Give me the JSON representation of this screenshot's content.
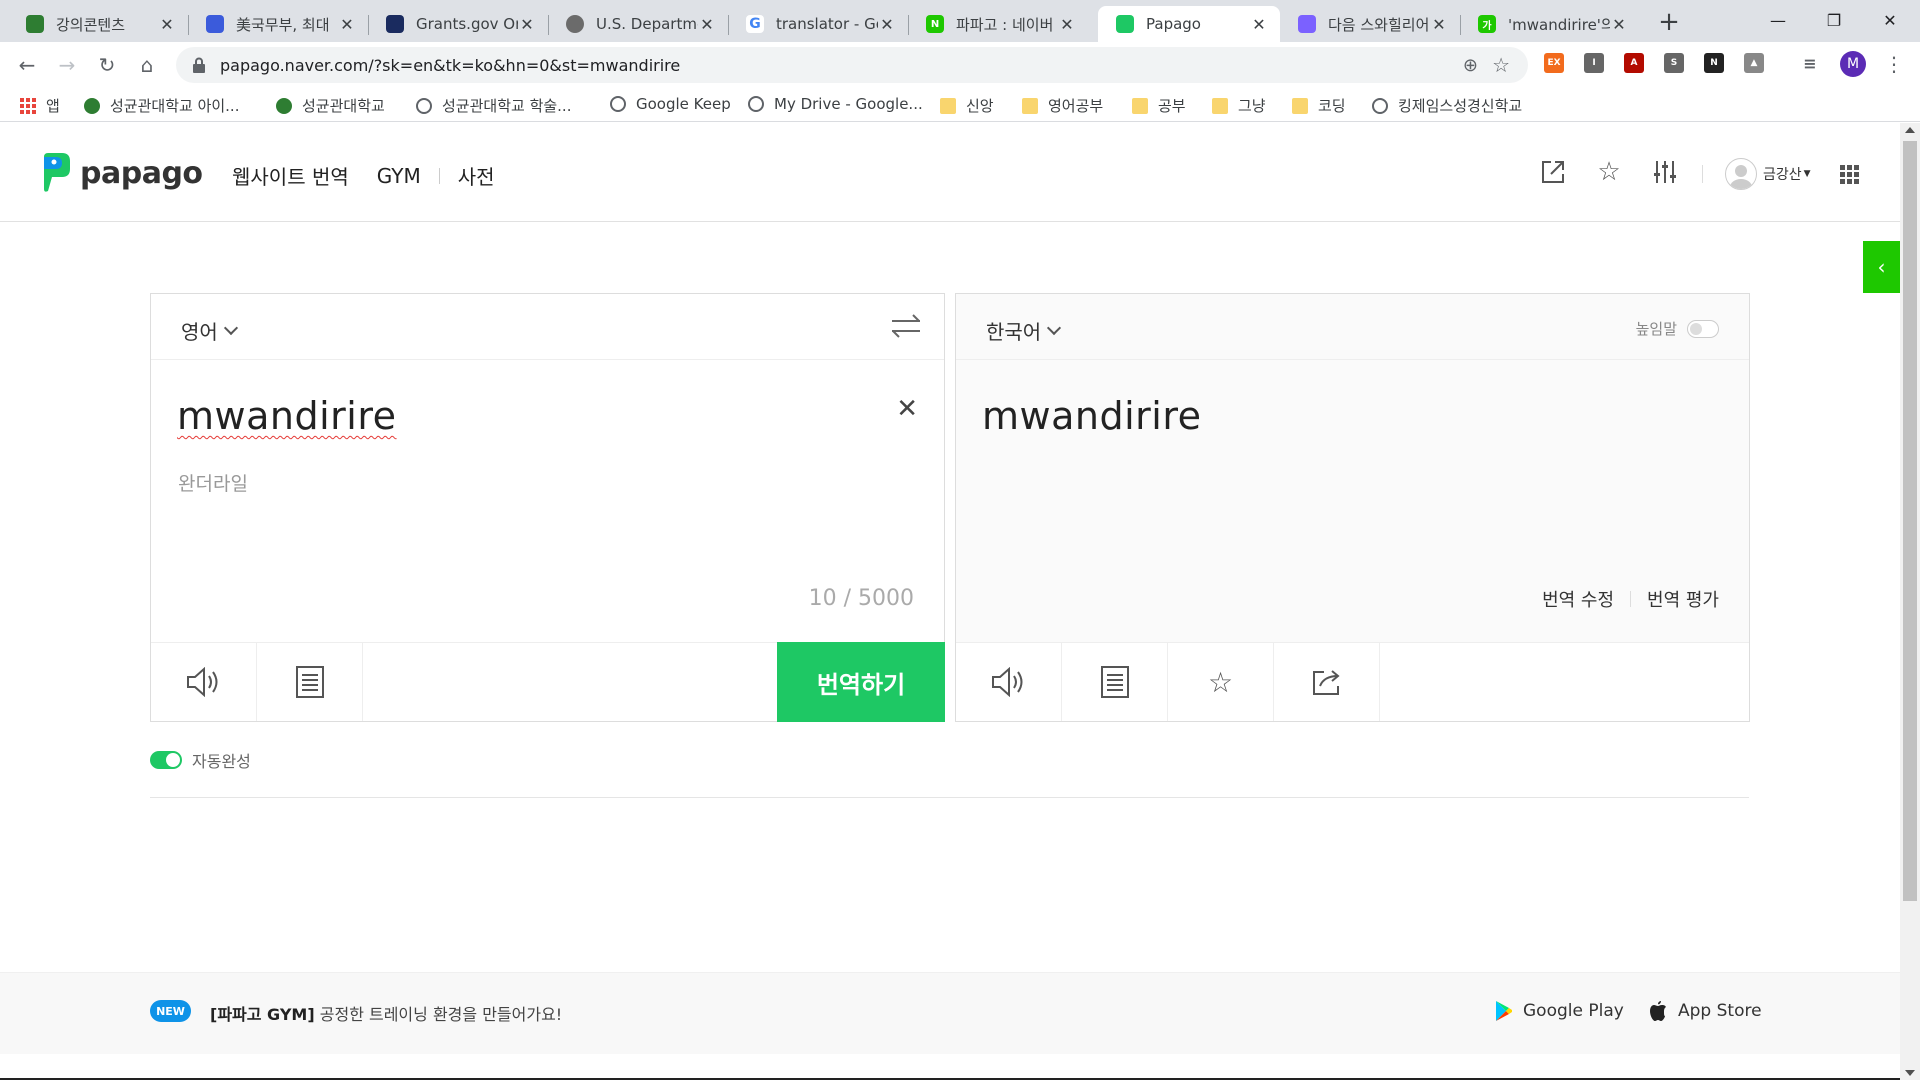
{
  "browser": {
    "tabs": [
      {
        "title": "강의콘텐츠",
        "favicon": "skku-icon",
        "color": "#2e7d32"
      },
      {
        "title": "美국무부, 최대",
        "favicon": "shield-icon",
        "color": "#3b5bdb"
      },
      {
        "title": "Grants.gov Onl",
        "favicon": "grants-icon",
        "color": "#1a2b5f"
      },
      {
        "title": "U.S. Departmen",
        "favicon": "seal-icon",
        "color": "#6b6b6b"
      },
      {
        "title": "translator - Go",
        "favicon": "google-icon",
        "color": "#4285f4"
      },
      {
        "title": "파파고 : 네이버",
        "favicon": "naver-icon",
        "color": "#1ec800"
      },
      {
        "title": "Papago",
        "favicon": "papago-icon",
        "color": "#1ec864"
      },
      {
        "title": "다음 스와힐리어",
        "favicon": "daum-icon",
        "color": "#7b61ff"
      },
      {
        "title": "'mwandirire'의",
        "favicon": "naver-dict-icon",
        "color": "#1ec800"
      }
    ],
    "active_tab": 6,
    "url": "papago.naver.com/?sk=en&tk=ko&hn=0&st=mwandirire",
    "profile_initial": "M",
    "bookmarks": [
      {
        "label": "앱",
        "icon": "apps-icon"
      },
      {
        "label": "성균관대학교 아이...",
        "icon": "skku-icon"
      },
      {
        "label": "성균관대학교",
        "icon": "skku-icon"
      },
      {
        "label": "성균관대학교 학술...",
        "icon": "globe-icon"
      },
      {
        "label": "Google Keep",
        "icon": "globe-icon"
      },
      {
        "label": "My Drive - Google...",
        "icon": "globe-icon"
      },
      {
        "label": "신앙",
        "icon": "folder-icon"
      },
      {
        "label": "영어공부",
        "icon": "folder-icon"
      },
      {
        "label": "공부",
        "icon": "folder-icon"
      },
      {
        "label": "그냥",
        "icon": "folder-icon"
      },
      {
        "label": "코딩",
        "icon": "folder-icon"
      },
      {
        "label": "킹제임스성경신학교",
        "icon": "globe-icon"
      }
    ]
  },
  "papago": {
    "brand": "papago",
    "nav": [
      "웹사이트 번역",
      "GYM",
      "사전"
    ],
    "user_name": "금강산",
    "source": {
      "language": "영어",
      "text": "mwandirire",
      "pronunciation": "완더라일",
      "count": "10 / 5000"
    },
    "target": {
      "language": "한국어",
      "text": "mwandirire",
      "honorific_label": "높임말",
      "edit_label": "번역 수정",
      "rate_label": "번역 평가"
    },
    "translate_button": "번역하기",
    "autocomplete_label": "자동완성",
    "footer": {
      "badge": "NEW",
      "notice_bold": "[파파고 GYM]",
      "notice_text": "공정한 트레이닝 환경을 만들어가요!",
      "google_play": "Google Play",
      "app_store": "App Store"
    },
    "colors": {
      "brand_green": "#1ec864",
      "naver_green": "#1ec800",
      "badge_blue": "#0e93e8"
    }
  }
}
